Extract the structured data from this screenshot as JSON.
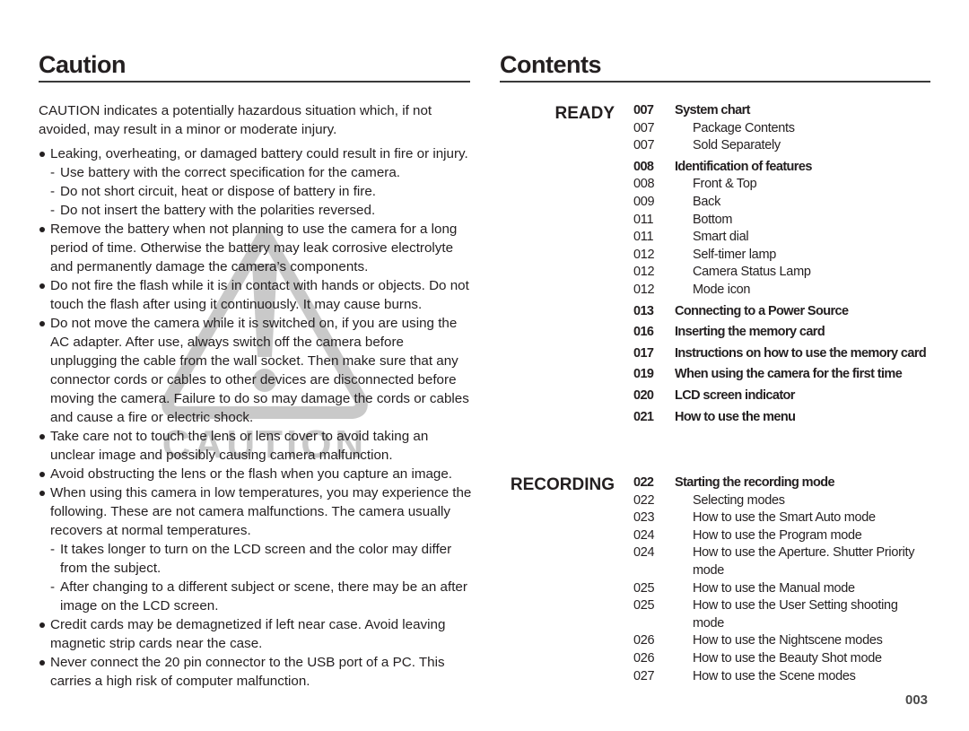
{
  "caution": {
    "title": "Caution",
    "intro": "CAUTION indicates a potentially hazardous situation which, if not avoided, may result in a minor or moderate injury.",
    "watermark_text": "CAUTION",
    "items": [
      {
        "text": "Leaking, overheating, or damaged battery could result in fire or injury.",
        "subs": [
          "Use battery with the correct specification for the camera.",
          "Do not short circuit, heat or dispose of battery in fire.",
          "Do not insert the battery with the polarities reversed."
        ]
      },
      {
        "text": "Remove the battery when not planning to use the camera for a long period of time. Otherwise the battery may leak corrosive electrolyte and permanently damage the camera’s components.",
        "subs": []
      },
      {
        "text": "Do not fire the flash while it is in contact with hands or objects. Do not touch the flash after using it continuously. It may cause burns.",
        "subs": []
      },
      {
        "text": "Do not move the camera while it is switched on, if you are using the AC adapter. After use, always switch off the camera before unplugging the cable from the wall socket. Then make sure that any connector cords or cables to other devices are disconnected before moving the camera. Failure to do so may damage the cords or cables and cause a fire or electric shock.",
        "subs": []
      },
      {
        "text": "Take care not to touch the lens or lens cover to avoid taking an unclear image and possibly causing camera malfunction.",
        "subs": []
      },
      {
        "text": "Avoid obstructing the lens or the flash when you capture an image.",
        "subs": []
      },
      {
        "text": "When using this camera in low temperatures, you may experience the following. These are not camera malfunctions. The camera usually recovers at normal temperatures.",
        "subs": [
          "It takes longer to turn on the LCD screen and the color may differ from the subject.",
          "After changing to a different subject or scene, there may be an after image on the LCD screen."
        ]
      },
      {
        "text": "Credit cards may be demagnetized if left near case. Avoid leaving magnetic strip cards near the case.",
        "subs": []
      },
      {
        "text": "Never connect the 20 pin connector to the USB port of a PC. This carries a high risk of computer malfunction.",
        "subs": []
      }
    ]
  },
  "contents": {
    "title": "Contents",
    "sections": [
      {
        "label": "READY",
        "entries": [
          {
            "page": "007",
            "title": "System chart",
            "level": "main"
          },
          {
            "page": "007",
            "title": "Package Contents",
            "level": "sub"
          },
          {
            "page": "007",
            "title": "Sold Separately",
            "level": "sub"
          },
          {
            "page": "008",
            "title": "Identification of features",
            "level": "main"
          },
          {
            "page": "008",
            "title": "Front & Top",
            "level": "sub"
          },
          {
            "page": "009",
            "title": "Back",
            "level": "sub"
          },
          {
            "page": "011",
            "title": "Bottom",
            "level": "sub"
          },
          {
            "page": "011",
            "title": "Smart dial",
            "level": "sub"
          },
          {
            "page": "012",
            "title": "Self-timer lamp",
            "level": "sub"
          },
          {
            "page": "012",
            "title": "Camera Status Lamp",
            "level": "sub"
          },
          {
            "page": "012",
            "title": "Mode icon",
            "level": "sub"
          },
          {
            "page": "013",
            "title": "Connecting to a Power Source",
            "level": "main"
          },
          {
            "page": "016",
            "title": "Inserting the memory card",
            "level": "main"
          },
          {
            "page": "017",
            "title": "Instructions on how to use the memory card",
            "level": "main"
          },
          {
            "page": "019",
            "title": "When using the camera for the first time",
            "level": "main"
          },
          {
            "page": "020",
            "title": "LCD screen indicator",
            "level": "main"
          },
          {
            "page": "021",
            "title": "How to use the menu",
            "level": "main"
          }
        ]
      },
      {
        "label": "RECORDING",
        "entries": [
          {
            "page": "022",
            "title": "Starting the recording mode",
            "level": "main"
          },
          {
            "page": "022",
            "title": "Selecting modes",
            "level": "sub"
          },
          {
            "page": "023",
            "title": "How to use the Smart Auto mode",
            "level": "sub"
          },
          {
            "page": "024",
            "title": "How to use the Program mode",
            "level": "sub"
          },
          {
            "page": "024",
            "title": "How to use the Aperture. Shutter Priority mode",
            "level": "sub"
          },
          {
            "page": "025",
            "title": "How to use the Manual mode",
            "level": "sub"
          },
          {
            "page": "025",
            "title": "How to use the User Setting shooting mode",
            "level": "sub"
          },
          {
            "page": "026",
            "title": "How to use the Nightscene modes",
            "level": "sub"
          },
          {
            "page": "026",
            "title": "How to use the Beauty Shot mode",
            "level": "sub"
          },
          {
            "page": "027",
            "title": "How to use the Scene modes",
            "level": "sub"
          }
        ]
      }
    ]
  },
  "page_number": "003"
}
